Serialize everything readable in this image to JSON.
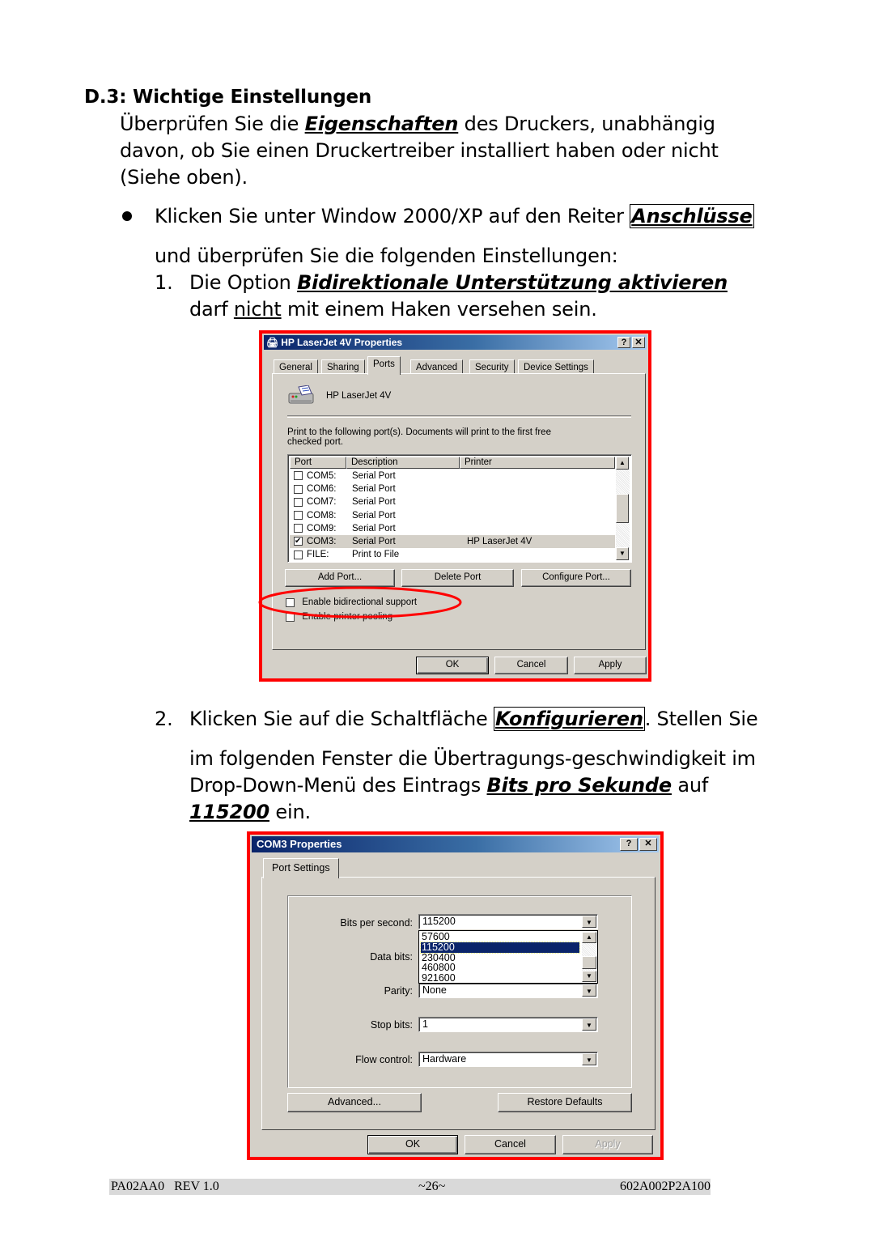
{
  "section": {
    "heading": "D.3: Wichtige Einstellungen",
    "intro": {
      "line1_pre": "Überprüfen Sie die ",
      "line1_em": "Eigenschaften",
      "line1_post": " des Druckers, unabhängig",
      "line2": "davon, ob Sie einen Druckertreiber installiert haben oder nicht",
      "line3": "(Siehe oben)."
    },
    "bullet": {
      "pre": "Klicken Sie unter Window 2000/XP auf den Reiter ",
      "em": "Anschlüsse",
      "line2": "und überprüfen Sie die folgenden Einstellungen:"
    },
    "step1": {
      "num": "1.",
      "pre": "Die Option ",
      "em": "Bidirektionale Unterstützung aktivieren",
      "line2_pre": "darf ",
      "line2_ul": "nicht",
      "line2_post": " mit einem Haken versehen sein."
    },
    "step2": {
      "num": "2.",
      "pre": "Klicken Sie auf die Schaltfläche ",
      "em": "Konfigurieren",
      "post": ". Stellen Sie",
      "line2": "im folgenden Fenster die Übertragungs-geschwindigkeit im",
      "line3_pre": "Drop-Down-Menü des Eintrags ",
      "line3_em": "Bits pro Sekunde",
      "line3_post": " auf",
      "line4_em": "115200",
      "line4_post": " ein."
    }
  },
  "dialog1": {
    "title": "HP LaserJet 4V Properties",
    "help_btn": "?",
    "close_btn": "✕",
    "tabs": [
      "General",
      "Sharing",
      "Ports",
      "Advanced",
      "Security",
      "Device Settings"
    ],
    "active_tab": "Ports",
    "printer_name": "HP LaserJet 4V",
    "instructions": "Print to the following port(s). Documents will print to the first free checked port.",
    "instructions_l1": "Print to the following port(s). Documents will print to the first free",
    "instructions_l2": "checked port.",
    "columns": [
      "Port",
      "Description",
      "Printer"
    ],
    "rows": [
      {
        "port": "COM5:",
        "description": "Serial Port",
        "printer": "",
        "checked": false
      },
      {
        "port": "COM6:",
        "description": "Serial Port",
        "printer": "",
        "checked": false
      },
      {
        "port": "COM7:",
        "description": "Serial Port",
        "printer": "",
        "checked": false
      },
      {
        "port": "COM8:",
        "description": "Serial Port",
        "printer": "",
        "checked": false
      },
      {
        "port": "COM9:",
        "description": "Serial Port",
        "printer": "",
        "checked": false
      },
      {
        "port": "COM3:",
        "description": "Serial Port",
        "printer": "HP LaserJet 4V",
        "checked": true
      },
      {
        "port": "FILE:",
        "description": "Print to File",
        "printer": "",
        "checked": false
      }
    ],
    "buttons": {
      "add": "Add Port...",
      "delete": "Delete Port",
      "configure": "Configure Port..."
    },
    "options": {
      "bidirectional": "Enable bidirectional support",
      "pooling": "Enable printer pooling"
    },
    "footer_buttons": {
      "ok": "OK",
      "cancel": "Cancel",
      "apply": "Apply"
    }
  },
  "dialog2": {
    "title": "COM3 Properties",
    "help_btn": "?",
    "close_btn": "✕",
    "tab": "Port Settings",
    "fields": {
      "bits_per_second": {
        "label": "Bits per second:",
        "value": "115200"
      },
      "data_bits": {
        "label": "Data bits:"
      },
      "parity": {
        "label": "Parity:",
        "value": "None"
      },
      "stop_bits": {
        "label": "Stop bits:",
        "value": "1"
      },
      "flow_control": {
        "label": "Flow control:",
        "value": "Hardware"
      }
    },
    "dropdown_options": [
      "57600",
      "115200",
      "230400",
      "460800",
      "921600"
    ],
    "dropdown_selected": "115200",
    "buttons": {
      "advanced": "Advanced...",
      "restore": "Restore Defaults"
    },
    "footer_buttons": {
      "ok": "OK",
      "cancel": "Cancel",
      "apply": "Apply"
    }
  },
  "footer": {
    "left": "PA02AA0   REV 1.0",
    "center": "~26~",
    "right": "602A002P2A100"
  },
  "colors": {
    "highlight_frame": "#ff0000",
    "titlebar": "#0a246a",
    "dialog_bg": "#d4d0c8",
    "selection": "#0a246a"
  }
}
